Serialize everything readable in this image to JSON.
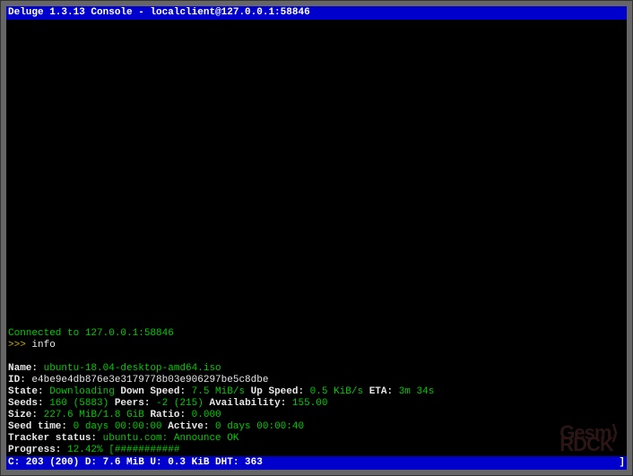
{
  "header": {
    "app": "Deluge 1.3.13 Console",
    "sep": " - ",
    "client": "localclient@127.0.0.1:58846"
  },
  "connection": {
    "msg": "Connected to 127.0.0.1:58846"
  },
  "prompt": {
    "mark": ">>> ",
    "command": "info"
  },
  "torrent": {
    "name_label": "Name:",
    "name": " ubuntu-18.04-desktop-amd64.iso",
    "id_label": "ID:",
    "id": " e4be9e4db876e3e3179778b03e906297be5c8dbe",
    "state_label": "State:",
    "state": " Downloading",
    "down_speed_label": " Down Speed:",
    "down_speed": " 7.5 MiB/s",
    "up_speed_label": " Up Speed:",
    "up_speed": " 0.5 KiB/s",
    "eta_label": " ETA:",
    "eta": " 3m 34s",
    "seeds_label": "Seeds:",
    "seeds": " 160 (5883)",
    "peers_label": " Peers:",
    "peers": " -2 (215)",
    "avail_label": " Availability:",
    "avail": " 155.00",
    "size_label": "Size:",
    "size": " 227.6 MiB/1.8 GiB",
    "ratio_label": " Ratio:",
    "ratio": " 0.000",
    "seedtime_label": "Seed time:",
    "seedtime": " 0 days 00:00:00",
    "active_label": " Active:",
    "active": " 0 days 00:00:40",
    "tracker_label": "Tracker status:",
    "tracker": " ubuntu.com: Announce OK",
    "progress_label": "Progress:",
    "progress_pct": " 12.42%",
    "progress_bar": " [###########"
  },
  "status": {
    "text": "C: 203 (200) D: 7.6 MiB U: 0.3 KiB DHT: 363",
    "tail": "]"
  },
  "watermark": "Gesm\nRDCK"
}
